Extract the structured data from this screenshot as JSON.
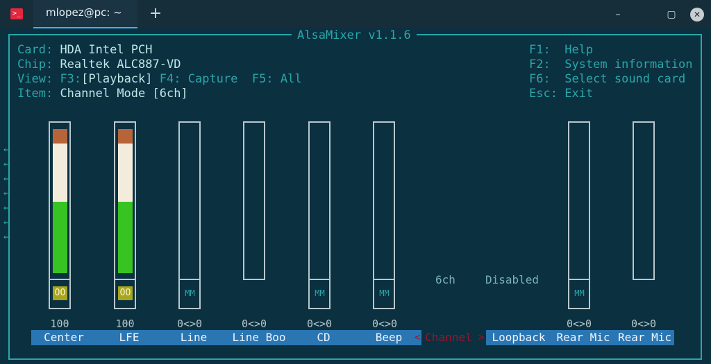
{
  "window": {
    "tab_title": "mlopez@pc: ~",
    "new_tab": "+",
    "minimize": "–",
    "maximize": "▢",
    "close": "✕"
  },
  "mixer": {
    "title": "AlsaMixer v1.1.6",
    "info": {
      "card_label": "Card:",
      "card_value": "HDA Intel PCH",
      "chip_label": "Chip:",
      "chip_value": "Realtek ALC887-VD",
      "view_label": "View:",
      "view_f3": "F3:",
      "view_playback": "[Playback]",
      "view_f4": "F4:",
      "view_capture": "Capture",
      "view_f5": "F5:",
      "view_all": "All",
      "item_label": "Item:",
      "item_value": "Channel Mode [6ch]"
    },
    "keys": [
      {
        "key": "F1:",
        "action": "Help"
      },
      {
        "key": "F2:",
        "action": "System information"
      },
      {
        "key": "F6:",
        "action": "Select sound card"
      },
      {
        "key": "Esc:",
        "action": "Exit"
      }
    ],
    "left_arrow": "←",
    "channels": [
      {
        "name": "Center",
        "level": "100",
        "switch": "OO"
      },
      {
        "name": "LFE",
        "level": "100",
        "switch": "OO"
      },
      {
        "name": "Line",
        "level": "0<>0",
        "switch": "MM"
      },
      {
        "name": "Line Boo",
        "level": "0<>0",
        "switch": ""
      },
      {
        "name": "CD",
        "level": "0<>0",
        "switch": "MM"
      },
      {
        "name": "Beep",
        "level": "0<>0",
        "switch": "MM"
      },
      {
        "name": "Channel",
        "enum_value": "6ch",
        "selected": true
      },
      {
        "name": "Loopback",
        "enum_value": "Disabled"
      },
      {
        "name": "Rear Mic",
        "level": "0<>0",
        "switch": "MM"
      },
      {
        "name": "Rear Mic",
        "level": "0<>0",
        "switch": ""
      }
    ],
    "selection_marks": {
      "left": "<",
      "right": ">"
    }
  },
  "colors": {
    "background": "#0b3040",
    "accent": "#2aa7a9",
    "label_bg": "#2a76b3",
    "selected": "#a0132a",
    "meter_green": "#37c422",
    "meter_white": "#f3ecdd",
    "meter_red": "#b8643b"
  }
}
